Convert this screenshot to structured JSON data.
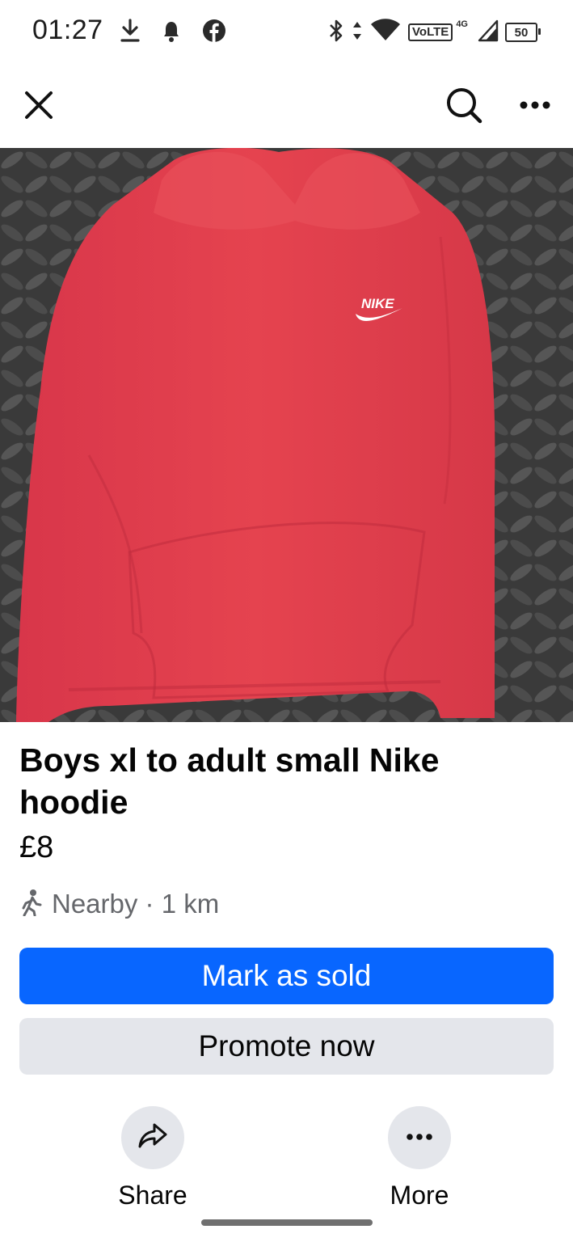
{
  "status_bar": {
    "time": "01:27",
    "volte_label": "VoLTE",
    "network_label": "4G",
    "battery_level": "50",
    "left_icons": [
      "download-icon",
      "notification-bell-icon",
      "facebook-icon"
    ],
    "right_icons": [
      "bluetooth-icon",
      "data-arrows-icon",
      "wifi-icon",
      "cell-signal-icon",
      "battery-icon"
    ]
  },
  "top_bar": {
    "close_icon": "close-icon",
    "search_icon": "search-icon",
    "more_icon": "more-horizontal-icon"
  },
  "listing": {
    "photo_brand_text": "NIKE",
    "title": "Boys xl to adult small Nike hoodie",
    "price": "£8",
    "location_icon": "walking-person-icon",
    "location": "Nearby · 1 km",
    "primary_button": "Mark as sold",
    "secondary_button": "Promote now"
  },
  "actions": {
    "share_label": "Share",
    "more_label": "More"
  },
  "colors": {
    "primary_blue": "#0866ff",
    "secondary_gray": "#e4e6eb",
    "hoodie_red": "#e23e4e",
    "muted_text": "#65676b"
  }
}
